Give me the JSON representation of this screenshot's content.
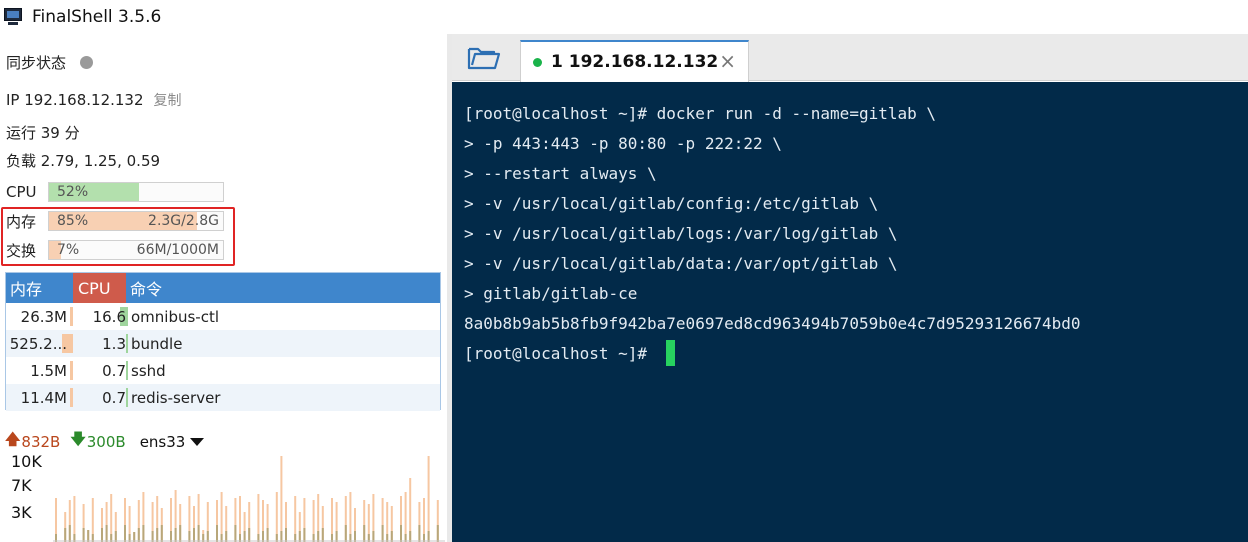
{
  "window": {
    "title": "FinalShell 3.5.6"
  },
  "status": {
    "sync_label": "同步状态",
    "ip_label": "IP 192.168.12.132",
    "copy_label": "复制",
    "uptime_label": "运行 39 分",
    "load_label": "负载 2.79, 1.25, 0.59"
  },
  "meters": {
    "cpu": {
      "label": "CPU",
      "percent_text": "52%",
      "fraction": 0.52,
      "color": "#b3e0ad"
    },
    "memory": {
      "label": "内存",
      "percent_text": "85%",
      "usage": "2.3G/2.8G",
      "fraction": 0.85,
      "color": "#f8d0b3"
    },
    "swap": {
      "label": "交换",
      "percent_text": "7%",
      "usage": "66M/1000M",
      "fraction": 0.07,
      "color": "#f8d0b3"
    }
  },
  "process_table": {
    "headers": {
      "memory": "内存",
      "cpu": "CPU",
      "command": "命令"
    },
    "rows": [
      {
        "memory": "26.3M",
        "cpu": "16.6",
        "command": "omnibus-ctl",
        "mem_fraction": 0.05,
        "cpu_fraction": 0.166
      },
      {
        "memory": "525.2...",
        "cpu": "1.3",
        "command": "bundle",
        "mem_fraction": 0.18,
        "cpu_fraction": 0.013
      },
      {
        "memory": "1.5M",
        "cpu": "0.7",
        "command": "sshd",
        "mem_fraction": 0.01,
        "cpu_fraction": 0.007
      },
      {
        "memory": "11.4M",
        "cpu": "0.7",
        "command": "redis-server",
        "mem_fraction": 0.02,
        "cpu_fraction": 0.007
      }
    ]
  },
  "network": {
    "upload": "832B",
    "download": "300B",
    "interface": "ens33",
    "yticks": [
      "10K",
      "7K",
      "3K"
    ]
  },
  "tabs": [
    {
      "title": "1 192.168.12.132",
      "status_color": "#1ab34a"
    }
  ],
  "terminal": {
    "lines": [
      "[root@localhost ~]# docker run -d --name=gitlab \\",
      "> -p 443:443 -p 80:80 -p 222:22 \\",
      "> --restart always \\",
      "> -v /usr/local/gitlab/config:/etc/gitlab \\",
      "> -v /usr/local/gitlab/logs:/var/log/gitlab \\",
      "> -v /usr/local/gitlab/data:/var/opt/gitlab \\",
      "> gitlab/gitlab-ce",
      "8a0b8b9ab5b8fb9f942ba7e0697ed8cd963494b7059b0e4c7d95293126674bd0"
    ],
    "prompt": "[root@localhost ~]# "
  }
}
